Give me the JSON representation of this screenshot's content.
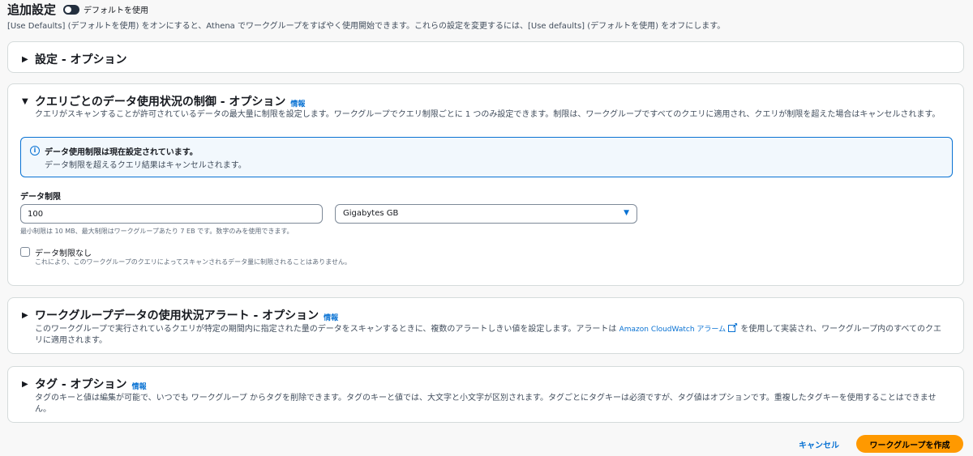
{
  "header": {
    "title": "追加設定",
    "toggle_label": "デフォルトを使用",
    "toggle_on": true,
    "description": "[Use Defaults] (デフォルトを使用) をオンにすると、Athena でワークグループをすばやく使用開始できます。これらの設定を変更するには、[Use defaults] (デフォルトを使用) をオフにします。"
  },
  "sections": {
    "settings": {
      "title": "設定 - オプション",
      "expanded": false
    },
    "data_usage": {
      "title": "クエリごとのデータ使用状況の制御 - オプション",
      "info": "情報",
      "expanded": true,
      "description": "クエリがスキャンすることが許可されているデータの最大量に制限を設定します。ワークグループでクエリ制限ごとに 1 つのみ設定できます。制限は、ワークグループですべてのクエリに適用され、クエリが制限を超えた場合はキャンセルされます。",
      "alert_title": "データ使用制限は現在設定されています。",
      "alert_body": "データ制限を超えるクエリ結果はキャンセルされます。",
      "field_label": "データ制限",
      "limit_value": "100",
      "unit_value": "Gigabytes GB",
      "hint": "最小制限は 10 MB、最大制限はワークグループあたり 7 EB です。数字のみを使用できます。",
      "no_limit_label": "データ制限なし",
      "no_limit_desc": "これにより、このワークグループのクエリによってスキャンされるデータ量に制限されることはありません。",
      "no_limit_checked": false
    },
    "alerts": {
      "title": "ワークグループデータの使用状況アラート - オプション",
      "info": "情報",
      "expanded": false,
      "desc_before": "このワークグループで実行されているクエリが特定の期間内に指定された量のデータをスキャンするときに、複数のアラートしきい値を設定します。アラートは ",
      "desc_link": "Amazon CloudWatch アラーム",
      "desc_after": " を使用して実装され、ワークグループ内のすべてのクエリに適用されます。"
    },
    "tags": {
      "title": "タグ - オプション",
      "info": "情報",
      "expanded": false,
      "description": "タグのキーと値は編集が可能で、いつでも ワークグループ からタグを削除できます。タグのキーと値では、大文字と小文字が区別されます。タグごとにタグキーは必須ですが、タグ値はオプションです。重複したタグキーを使用することはできません。"
    }
  },
  "footer": {
    "cancel": "キャンセル",
    "create": "ワークグループを作成"
  },
  "colors": {
    "primary": "#ff9900",
    "link": "#0972d3",
    "toggle": "#232f3e"
  }
}
